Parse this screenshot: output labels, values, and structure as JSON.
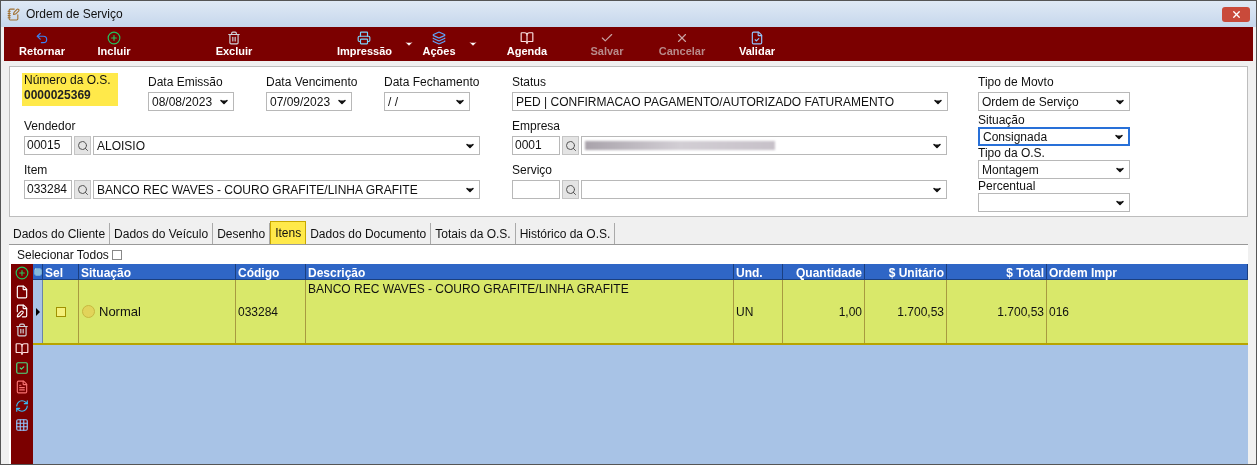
{
  "window": {
    "title": "Ordem de Serviço"
  },
  "toolbar": [
    {
      "label": "Retornar",
      "kind": "back",
      "disabled": false,
      "dropdown": false
    },
    {
      "label": "Incluir",
      "kind": "add",
      "disabled": false,
      "dropdown": false
    },
    {
      "label": "Excluir",
      "kind": "delete",
      "disabled": false,
      "dropdown": false
    },
    {
      "label": "Impressão",
      "kind": "print",
      "disabled": false,
      "dropdown": true
    },
    {
      "label": "Ações",
      "kind": "actions",
      "disabled": false,
      "dropdown": true
    },
    {
      "label": "Agenda",
      "kind": "agenda",
      "disabled": false,
      "dropdown": false
    },
    {
      "label": "Salvar",
      "kind": "save",
      "disabled": true,
      "dropdown": false
    },
    {
      "label": "Cancelar",
      "kind": "cancel",
      "disabled": true,
      "dropdown": false
    },
    {
      "label": "Validar",
      "kind": "validate",
      "disabled": false,
      "dropdown": false
    }
  ],
  "form": {
    "os_number": {
      "label": "Número da O.S.",
      "value": "0000025369"
    },
    "dates": [
      {
        "label": "Data Emissão",
        "value": "08/08/2023"
      },
      {
        "label": "Data Vencimento",
        "value": "07/09/2023"
      },
      {
        "label": "Data Fechamento",
        "value": "/ /"
      }
    ],
    "vendedor": {
      "label": "Vendedor",
      "code": "00015",
      "value": "ALOISIO"
    },
    "item": {
      "label": "Item",
      "code": "033284",
      "value": "BANCO REC WAVES - COURO GRAFITE/LINHA GRAFITE"
    },
    "status": {
      "label": "Status",
      "value": "PED | CONFIRMACAO PAGAMENTO/AUTORIZADO FATURAMENTO"
    },
    "empresa": {
      "label": "Empresa",
      "code": "0001",
      "redacted": true
    },
    "servico": {
      "label": "Serviço"
    },
    "right": [
      {
        "label": "Tipo de Movto",
        "value": "Ordem de Serviço",
        "focused": false
      },
      {
        "label": "Situação",
        "value": "Consignada",
        "focused": true
      },
      {
        "label": "Tipo da O.S.",
        "value": "Montagem",
        "focused": false
      },
      {
        "label": "Percentual",
        "focused": false
      }
    ]
  },
  "tabs": [
    {
      "label": "Dados do Cliente",
      "selected": false
    },
    {
      "label": "Dados do Veículo",
      "selected": false
    },
    {
      "label": "Desenho",
      "selected": false
    },
    {
      "label": "Itens",
      "selected": true
    },
    {
      "label": "Dados do Documento",
      "selected": false
    },
    {
      "label": "Totais da O.S.",
      "selected": false
    },
    {
      "label": "Histórico da O.S.",
      "selected": false
    }
  ],
  "select_all": {
    "label": "Selecionar Todos",
    "checked": false
  },
  "side_tools": [
    {
      "kind": "add"
    },
    {
      "kind": "file"
    },
    {
      "kind": "edit"
    },
    {
      "kind": "delete"
    },
    {
      "kind": "book"
    },
    {
      "kind": "check"
    },
    {
      "kind": "pdf"
    },
    {
      "kind": "refresh"
    },
    {
      "kind": "grid"
    }
  ],
  "table": {
    "columns": [
      {
        "label": "Sel"
      },
      {
        "label": "Situação"
      },
      {
        "label": "Código"
      },
      {
        "label": "Descrição"
      },
      {
        "label": "Und."
      },
      {
        "label": "Quantidade"
      },
      {
        "label": "$ Unitário"
      },
      {
        "label": "$ Total"
      },
      {
        "label": "Ordem Impr"
      }
    ],
    "rows": [
      {
        "current": true,
        "checked": false,
        "situacao": "Normal",
        "codigo": "033284",
        "descricao": "BANCO REC WAVES - COURO GRAFITE/LINHA GRAFITE",
        "und": "UN",
        "quantidade": "1,00",
        "unitario": "1.700,53",
        "total": "1.700,53",
        "ordem": "016"
      }
    ]
  }
}
